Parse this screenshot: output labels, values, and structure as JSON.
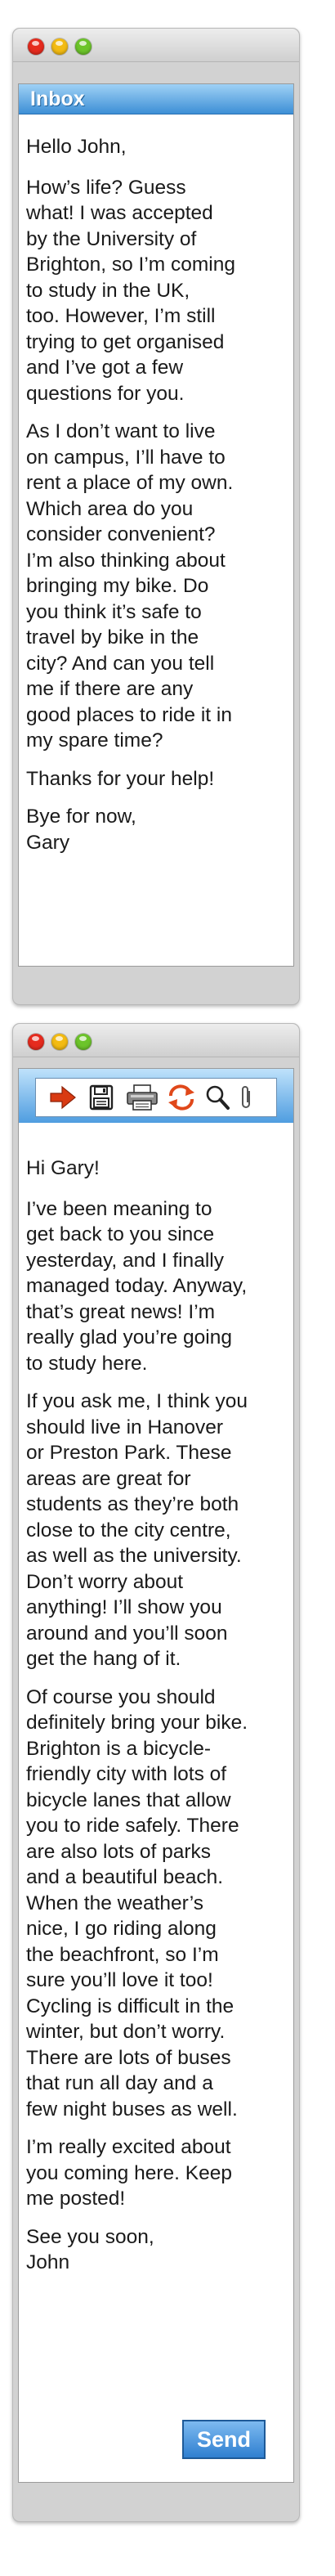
{
  "window1": {
    "inbox_label": "Inbox",
    "paragraphs": [
      [
        "Hello John,"
      ],
      [
        "How’s life? Guess",
        "what! I was accepted",
        "by the University of",
        "Brighton, so I’m coming",
        "to study in the UK,",
        "too. However, I’m still",
        "trying to get organised",
        "and I’ve got a few",
        "questions for you."
      ],
      [
        "As I don’t want to live",
        "on campus, I’ll have to",
        "rent a place of my own.",
        "Which area do you",
        "consider convenient?",
        "I’m also thinking about",
        "bringing my bike. Do",
        "you think it’s safe to",
        "travel by bike in the",
        "city? And can you tell",
        "me if there are any",
        "good places to ride it in",
        "my spare time?"
      ],
      [
        "Thanks for your help!"
      ],
      [
        "Bye for now,",
        "Gary"
      ]
    ]
  },
  "window2": {
    "toolbar_icons": [
      "forward-arrow-icon",
      "save-icon",
      "print-icon",
      "refresh-icon",
      "search-icon",
      "attach-icon"
    ],
    "paragraphs": [
      [
        "Hi Gary!"
      ],
      [
        "I’ve been meaning to",
        "get back to you since",
        "yesterday, and I finally",
        "managed today. Anyway,",
        "that’s great news! I’m",
        "really glad you’re going",
        "to study here."
      ],
      [
        "If you ask me, I think you",
        "should live in Hanover",
        "or Preston Park. These",
        "areas are great for",
        "students as they’re both",
        "close to the city centre,",
        "as well as the university.",
        "Don’t worry about",
        "anything! I’ll show you",
        "around and you’ll soon",
        "get the hang of it."
      ],
      [
        "Of course you should",
        "definitely bring your bike.",
        "Brighton is a bicycle-",
        "friendly city with lots of",
        "bicycle lanes that allow",
        "you to ride safely. There",
        "are also lots of parks",
        "and a beautiful beach.",
        "When the weather’s",
        "nice, I go riding along",
        "the beachfront, so I’m",
        "sure you’ll love it too!",
        "Cycling is difficult in the",
        "winter, but don’t worry.",
        "There are lots of buses",
        "that run all day and a",
        "few night buses as well."
      ],
      [
        "I’m really excited about",
        "you coming here. Keep",
        "me posted!"
      ],
      [
        "See you soon,",
        "John"
      ]
    ],
    "send_label": "Send"
  },
  "colors": {
    "window_frame": "#d2d2d2",
    "header_blue": "#3d8fd6",
    "send_button": "#2f7fd0"
  }
}
